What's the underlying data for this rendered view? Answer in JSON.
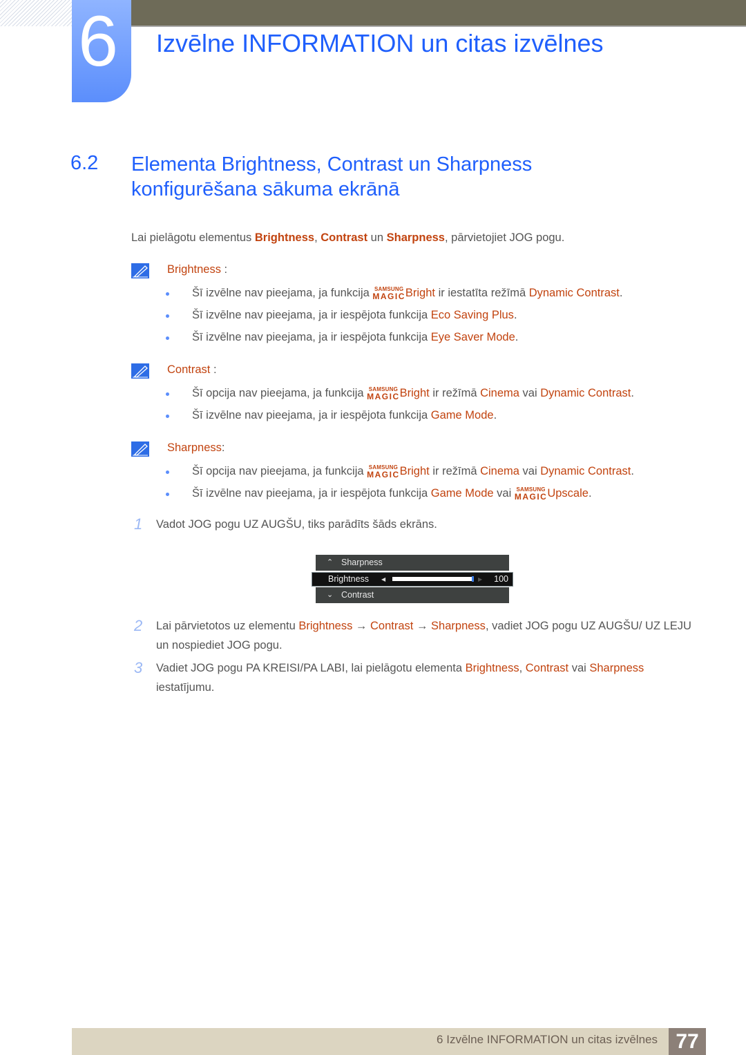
{
  "chapter": {
    "number": "6",
    "title": "Izvēlne INFORMATION un citas izvēlnes"
  },
  "section": {
    "number": "6.2",
    "title_line1": "Elementa Brightness, Contrast un Sharpness",
    "title_line2": "konfigurēšana sākuma ekrānā"
  },
  "intro": {
    "prefix": "Lai pielāgotu elementus ",
    "hl1": "Brightness",
    "sep1": ", ",
    "hl2": "Contrast",
    "sep2": " un ",
    "hl3": "Sharpness",
    "suffix": ", pārvietojiet JOG pogu."
  },
  "magic_logo": {
    "top": "SAMSUNG",
    "bottom": "MAGIC"
  },
  "notes": {
    "brightness": {
      "head": "Brightness",
      "colon": " :",
      "b1": {
        "pre": "Šī izvēlne nav pieejama, ja funkcija ",
        "magic": "Bright",
        "mid": " ir iestatīta režīmā ",
        "hl": "Dynamic Contrast",
        "post": "."
      },
      "b2": {
        "pre": "Šī izvēlne nav pieejama, ja ir iespējota funkcija ",
        "hl": "Eco Saving Plus",
        "post": "."
      },
      "b3": {
        "pre": "Šī izvēlne nav pieejama, ja ir iespējota funkcija ",
        "hl": "Eye Saver Mode",
        "post": "."
      }
    },
    "contrast": {
      "head": "Contrast",
      "colon": " :",
      "b1": {
        "pre": "Šī opcija nav pieejama, ja funkcija ",
        "magic": "Bright",
        "mid": " ir režīmā ",
        "hl1": "Cinema",
        "mid2": " vai ",
        "hl2": "Dynamic Contrast",
        "post": "."
      },
      "b2": {
        "pre": "Šī izvēlne nav pieejama, ja ir iespējota funkcija ",
        "hl": "Game Mode",
        "post": "."
      }
    },
    "sharpness": {
      "head": "Sharpness",
      "colon": ":",
      "b1": {
        "pre": "Šī opcija nav pieejama, ja funkcija ",
        "magic": "Bright",
        "mid": " ir režīmā ",
        "hl1": "Cinema",
        "mid2": " vai ",
        "hl2": "Dynamic Contrast",
        "post": "."
      },
      "b2": {
        "pre": "Šī izvēlne nav pieejama, ja ir iespējota funkcija ",
        "hl": "Game Mode",
        "mid": " vai ",
        "magic": "Upscale",
        "post": "."
      }
    }
  },
  "steps": [
    {
      "num": "1",
      "text": "Vadot JOG pogu UZ AUGŠU, tiks parādīts šāds ekrāns."
    },
    {
      "num": "2",
      "pre": "Lai pārvietotos uz elementu ",
      "hl1": "Brightness",
      "arrow1": " → ",
      "hl2": "Contrast",
      "arrow2": " → ",
      "hl3": "Sharpness",
      "post": ", vadiet JOG pogu UZ AUGŠU/ UZ LEJU un nospiediet JOG pogu."
    },
    {
      "num": "3",
      "pre": "Vadiet JOG pogu PA KREISI/PA LABI, lai pielāgotu elementa ",
      "hl1": "Brightness",
      "sep": ", ",
      "hl2": "Contrast",
      "mid": " vai ",
      "hl3": "Sharpness",
      "post": " iestatījumu."
    }
  ],
  "osd": {
    "up_item": "Sharpness",
    "selected_item": "Brightness",
    "selected_value": "100",
    "slider_percent": 100,
    "down_item": "Contrast"
  },
  "footer": {
    "text": "6 Izvēlne INFORMATION un citas izvēlnes",
    "page": "77"
  },
  "colors": {
    "accent_blue": "#1f5ffc",
    "highlight_orange": "#c24410",
    "topbar": "#6e6b58",
    "footer_bg": "#dcd5c1",
    "page_badge": "#8c8078"
  }
}
